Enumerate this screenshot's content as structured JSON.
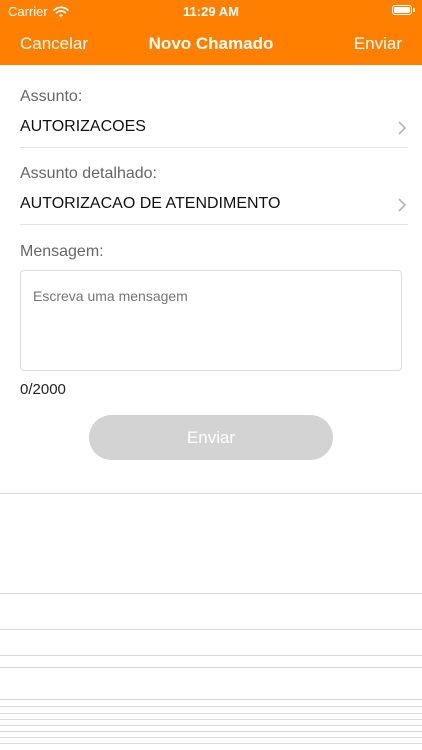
{
  "status_bar": {
    "carrier": "Carrier",
    "time": "11:29 AM",
    "icons": [
      "wifi-icon",
      "battery-icon"
    ]
  },
  "nav": {
    "left_label": "Cancelar",
    "title": "Novo Chamado",
    "right_label": "Enviar"
  },
  "form": {
    "subject": {
      "label": "Assunto:",
      "value": "AUTORIZACOES"
    },
    "detailed_subject": {
      "label": "Assunto detalhado:",
      "value": "AUTORIZACAO DE ATENDIMENTO"
    },
    "message": {
      "label": "Mensagem:",
      "value": "",
      "placeholder": "Escreva uma mensagem",
      "counter": "0/2000"
    },
    "submit_label": "Enviar"
  },
  "colors": {
    "header_bg": "#FF7F00",
    "header_text": "#FFFFFF",
    "button_disabled_bg": "#D3D3D3",
    "label_text": "#666666"
  }
}
